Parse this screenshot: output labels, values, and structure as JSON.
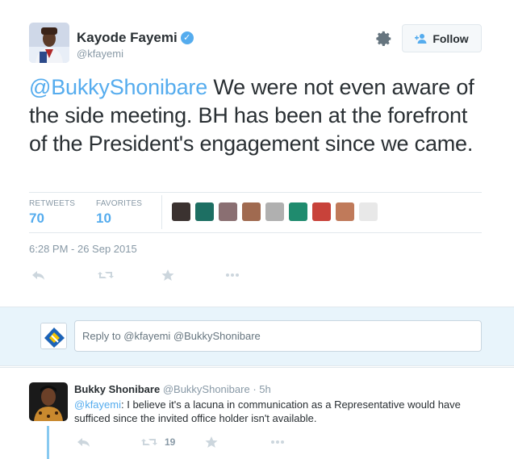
{
  "tweet": {
    "author_name": "Kayode Fayemi",
    "author_handle": "@kfayemi",
    "follow_label": "Follow",
    "text_mention": "@BukkyShonibare",
    "text_body": " We were not even aware of the side meeting. BH has been at the forefront of the President's engagement since we came.",
    "retweets_label": "RETWEETS",
    "retweets_count": "70",
    "favorites_label": "FAVORITES",
    "favorites_count": "10",
    "timestamp": "6:28 PM - 26 Sep 2015",
    "favoriter_colors": [
      "#3b3230",
      "#1d6f63",
      "#8a6f72",
      "#a06a50",
      "#b0b0b0",
      "#1f8b6e",
      "#c8423a",
      "#c07a5a",
      "#e8e8e8"
    ]
  },
  "reply_box": {
    "placeholder": "Reply to @kfayemi @BukkyShonibare"
  },
  "reply": {
    "author_name": "Bukky Shonibare",
    "author_handle": "@BukkyShonibare",
    "time": " · 5h",
    "text_mention": "@kfayemi",
    "text_body": ": I believe it's a lacuna in communication as a Representative would have sufficed since the invited office holder isn't available.",
    "retweet_count": "19"
  },
  "colors": {
    "link": "#55acee",
    "muted": "#8899a6",
    "reply_bg": "#e8f4fb",
    "thread": "#88c9f0"
  }
}
